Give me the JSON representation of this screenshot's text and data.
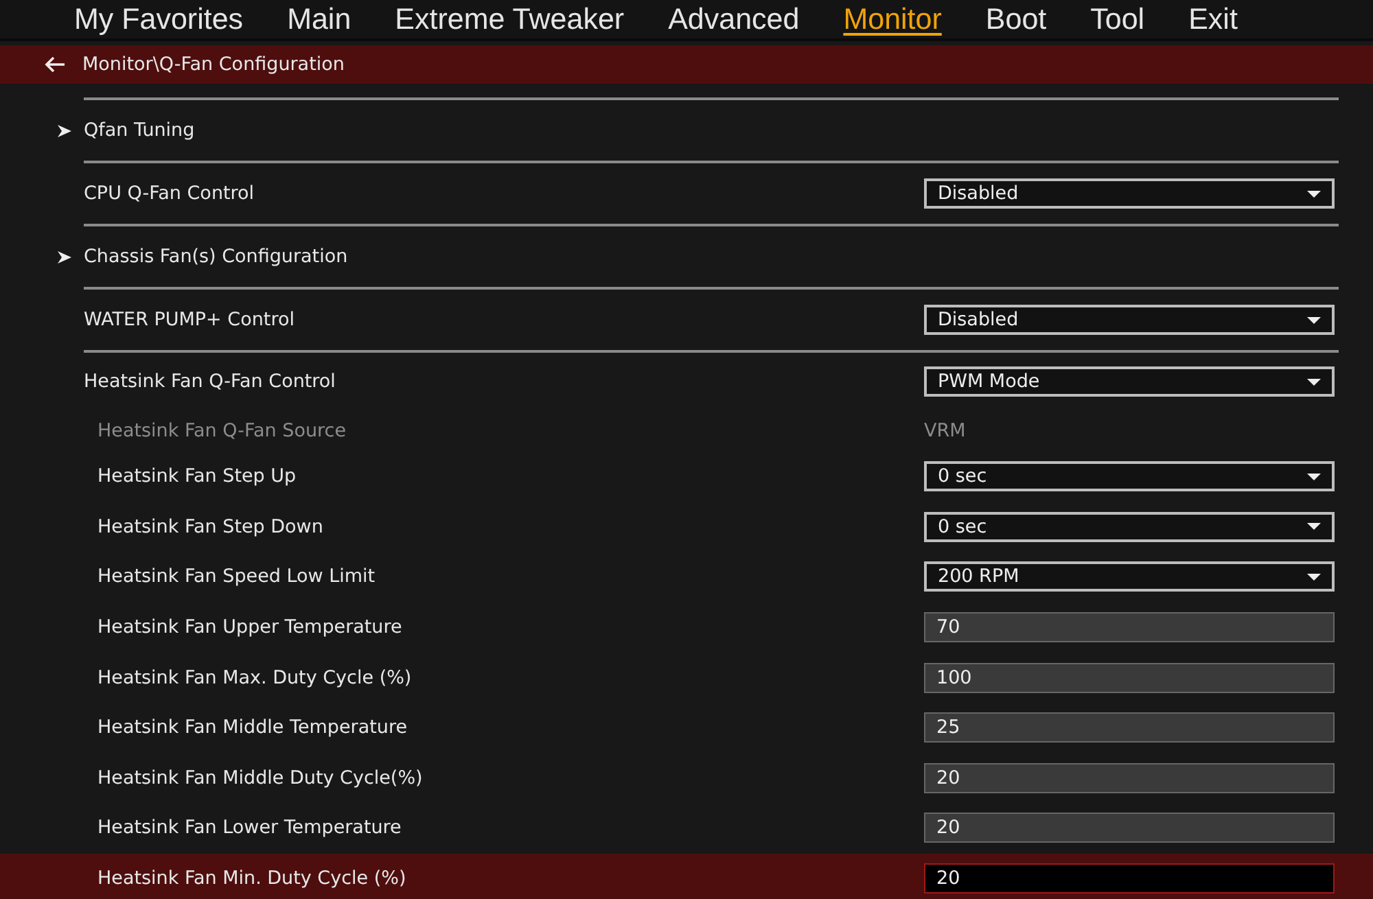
{
  "tabs": [
    {
      "label": "My Favorites",
      "selected": false
    },
    {
      "label": "Main",
      "selected": false
    },
    {
      "label": "Extreme Tweaker",
      "selected": false
    },
    {
      "label": "Advanced",
      "selected": false
    },
    {
      "label": "Monitor",
      "selected": true
    },
    {
      "label": "Boot",
      "selected": false
    },
    {
      "label": "Tool",
      "selected": false
    },
    {
      "label": "Exit",
      "selected": false
    }
  ],
  "breadcrumb": {
    "path": "Monitor\\Q-Fan Configuration"
  },
  "sections": [
    {
      "items": [
        {
          "kind": "submenu",
          "label": "Qfan Tuning",
          "disabled": false,
          "selected": false
        }
      ]
    },
    {
      "items": [
        {
          "kind": "dropdown",
          "label": "CPU Q-Fan Control",
          "value": "Disabled",
          "disabled": false,
          "selected": false
        }
      ]
    },
    {
      "items": [
        {
          "kind": "submenu",
          "label": "Chassis Fan(s) Configuration",
          "disabled": false,
          "selected": false
        }
      ]
    },
    {
      "items": [
        {
          "kind": "dropdown",
          "label": "WATER PUMP+ Control",
          "value": "Disabled",
          "disabled": false,
          "selected": false
        }
      ]
    },
    {
      "items": [
        {
          "kind": "dropdown",
          "label": "Heatsink Fan Q-Fan Control",
          "value": "PWM Mode",
          "disabled": false,
          "selected": false,
          "children": [
            {
              "kind": "info",
              "label": "Heatsink Fan Q-Fan Source",
              "value": "VRM",
              "disabled": true,
              "selected": false
            },
            {
              "kind": "dropdown",
              "label": "Heatsink Fan Step Up",
              "value": "0 sec",
              "disabled": false,
              "selected": false
            },
            {
              "kind": "dropdown",
              "label": "Heatsink Fan Step Down",
              "value": "0 sec",
              "disabled": false,
              "selected": false
            },
            {
              "kind": "dropdown",
              "label": "Heatsink Fan Speed Low Limit",
              "value": "200 RPM",
              "disabled": false,
              "selected": false
            },
            {
              "kind": "number",
              "label": "Heatsink Fan Upper Temperature",
              "value": "70",
              "disabled": false,
              "selected": false
            },
            {
              "kind": "number",
              "label": "Heatsink Fan Max. Duty Cycle (%)",
              "value": "100",
              "disabled": false,
              "selected": false
            },
            {
              "kind": "number",
              "label": "Heatsink Fan Middle Temperature",
              "value": "25",
              "disabled": false,
              "selected": false
            },
            {
              "kind": "number",
              "label": "Heatsink Fan Middle Duty Cycle(%)",
              "value": "20",
              "disabled": false,
              "selected": false
            },
            {
              "kind": "number",
              "label": "Heatsink Fan Lower Temperature",
              "value": "20",
              "disabled": false,
              "selected": false
            },
            {
              "kind": "number",
              "label": "Heatsink Fan Min. Duty Cycle (%)",
              "value": "20",
              "disabled": false,
              "selected": true
            }
          ]
        }
      ]
    }
  ]
}
